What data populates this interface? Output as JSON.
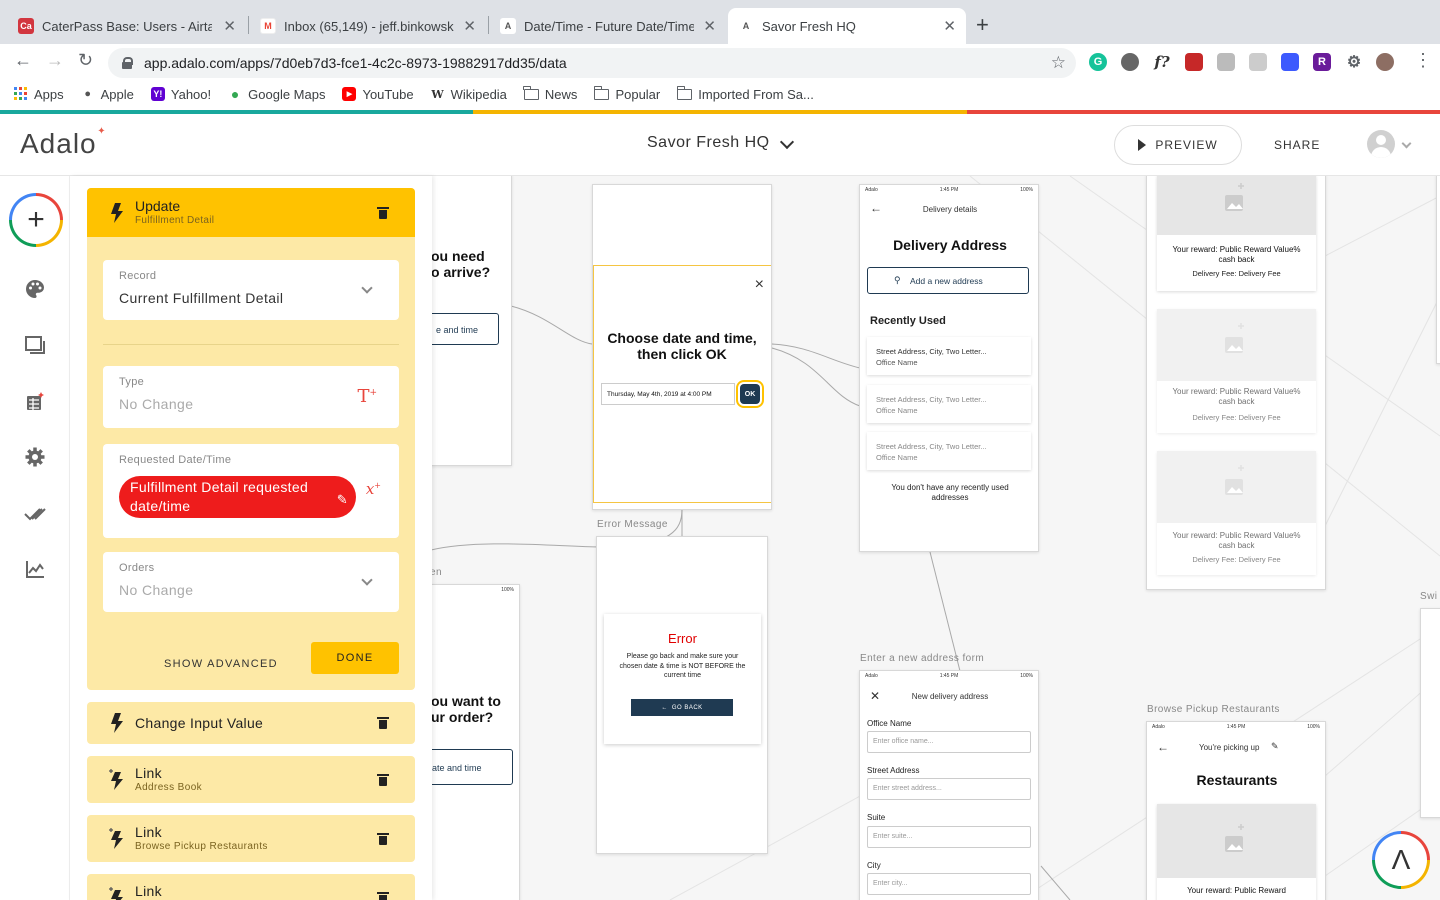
{
  "browser": {
    "tabs": [
      {
        "label": "CaterPass Base: Users - Airtab",
        "favicon": "Ca",
        "favcolor": "#d2363f",
        "close": "✕"
      },
      {
        "label": "Inbox (65,149) - jeff.binkowski",
        "favicon": "M",
        "favcolor": "#ea4335",
        "close": "✕"
      },
      {
        "label": "Date/Time - Future Date/Time (",
        "favicon": "A",
        "favcolor": "#777777",
        "close": "✕"
      },
      {
        "label": "Savor Fresh HQ",
        "favicon": "A",
        "favcolor": "#777777",
        "close": "✕"
      }
    ],
    "new_tab": "+",
    "url": "app.adalo.com/apps/7d0eb7d3-fce1-4c2c-8973-19882917dd35/data",
    "bookmarks": [
      {
        "label": "Apps",
        "icon": "apps-grid-icon"
      },
      {
        "label": "Apple",
        "icon": "apple-icon"
      },
      {
        "label": "Yahoo!",
        "icon": "yahoo-icon"
      },
      {
        "label": "Google Maps",
        "icon": "maps-pin-icon"
      },
      {
        "label": "YouTube",
        "icon": "youtube-icon"
      },
      {
        "label": "Wikipedia",
        "icon": "wikipedia-icon"
      },
      {
        "label": "News",
        "icon": "folder-icon"
      },
      {
        "label": "Popular",
        "icon": "folder-icon"
      },
      {
        "label": "Imported From Sa...",
        "icon": "folder-icon"
      }
    ]
  },
  "header": {
    "logo": "Adalo",
    "app_title": "Savor Fresh HQ",
    "preview_label": "PREVIEW",
    "share_label": "SHARE"
  },
  "panel": {
    "update_title": "Update",
    "update_sub": "Fulfillment Detail",
    "record_label": "Record",
    "record_value": "Current Fulfillment Detail",
    "type_label": "Type",
    "type_value": "No Change",
    "reqdt_label": "Requested Date/Time",
    "reqdt_value": "Fulfillment Detail requested date/time",
    "orders_label": "Orders",
    "orders_value": "No Change",
    "show_advanced": "SHOW ADVANCED",
    "done": "DONE",
    "actions": [
      {
        "title": "Change Input Value",
        "sub": ""
      },
      {
        "title": "Link",
        "sub": "Address Book"
      },
      {
        "title": "Link",
        "sub": "Browse Pickup Restaurants"
      },
      {
        "title": "Link",
        "sub": ""
      }
    ]
  },
  "canvas": {
    "partial_text_1": "ou need\no arrive?",
    "partial_btn_1": "e and time",
    "partial_label_en": "en",
    "partial_text_2": "ou want to\nur order?",
    "partial_btn_2": "ate and time",
    "datetime_title": "Choose date and time, then click OK",
    "datetime_value": "Thursday, May 4th, 2019 at 4:00 PM",
    "ok": "OK",
    "close": "×",
    "error_label": "Error Message",
    "error_title": "Error",
    "error_body": "Please go back and make sure your chosen date & time is NOT BEFORE the current time",
    "go_back": "GO BACK",
    "status_carrier": "Adalo",
    "status_time": "1:45 PM",
    "status_batt": "100%",
    "delivery_header": "Delivery details",
    "delivery_title": "Delivery Address",
    "add_address": "Add a new address",
    "recently_used": "Recently Used",
    "addr_line": "Street Address, City, Two Letter...",
    "addr_office": "Office Name",
    "no_recent": "You don't have any recently used addresses",
    "reward_line1": "Your reward: Public Reward Value% cash back",
    "reward_line2": "Delivery Fee: Delivery Fee",
    "new_addr_label": "Enter a new address form",
    "new_addr_header": "New delivery address",
    "office_name": "Office Name",
    "office_ph": "Enter office name...",
    "street": "Street Address",
    "street_ph": "Enter street address...",
    "suite": "Suite",
    "suite_ph": "Enter suite...",
    "city": "City",
    "city_ph": "Enter city...",
    "pickup_label": "Browse Pickup Restaurants",
    "pickup_header": "You're picking up",
    "restaurants": "Restaurants",
    "reward_short": "Your reward: Public Reward",
    "swi": "Swi"
  },
  "colors": {
    "brand_yellow": "#ffc200",
    "panel_yellow": "#fde9a6",
    "error_red": "#e00000",
    "pill_red": "#ee1c1c",
    "navy": "#1f3a52"
  }
}
